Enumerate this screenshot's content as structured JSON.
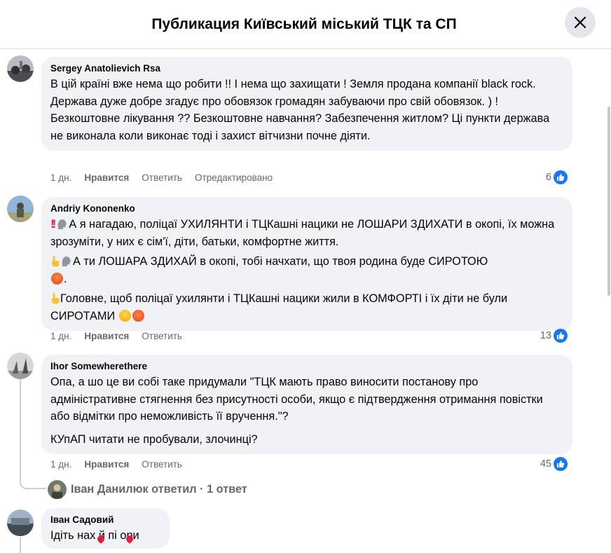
{
  "header": {
    "title": "Публикация Київський міський ТЦК та СП"
  },
  "comments": [
    {
      "author": "Sergey Anatolievich Rsa",
      "text": "В цій країні вже нема що робити !! І нема що захищати ! Земля продана компанії black rock. Держава дуже добре згадує про обовязок громадян забуваючи про свій обовязок. ) ! Безкоштовне лікування ?? Безкоштовне навчання? Забезпечення житлом? Ці пункти держава не виконала коли виконає тоді і захист вітчизни почне діяти.",
      "time": "1 дн.",
      "like": "Нравится",
      "reply": "Ответить",
      "edited": "Отредактировано",
      "likes": "6"
    },
    {
      "author": "Andriy Kononenko",
      "p1": "А я нагадаю, поліцаї УХИЛЯНТИ і ТЦКашні нацики не ЛОШАРИ ЗДИХАТИ в окопі, їх можна зрозуміти, у них є сім'ї, діти, батьки, комфортне життя.",
      "p2": "А ти ЛОШАРА ЗДИХАЙ в окопі, тобі начхати, що твоя родина буде СИРОТОЮ",
      "p2_end": ".",
      "p3": "Головне, щоб поліцаї ухилянти і ТЦКашні нацики жили в КОМФОРТІ і їх діти не були СИРОТАМИ",
      "time": "1 дн.",
      "like": "Нравится",
      "reply": "Ответить",
      "likes": "13"
    },
    {
      "author": "Ihor Somewherethere",
      "p1": "Опа, а шо це ви собі таке придумали \"ТЦК мають право виносити постанову про адміністративне стягнення без присутності особи, якщо є підтвердження отримання повістки або відмітки про неможливість її вручення.\"?",
      "p2": "КУпАП читати не пробували, злочинці?",
      "time": "1 дн.",
      "like": "Нравится",
      "reply": "Ответить",
      "likes": "45"
    },
    {
      "author": "Іван Садовий",
      "text": "Ідіть нах й пі ори"
    }
  ],
  "reply_summary": {
    "text": "Іван Данилюк ответил · 1 ответ"
  },
  "colors": {
    "like_blue": "#1877f2",
    "bubble_bg": "#f0f2f5",
    "muted": "#65676b"
  }
}
